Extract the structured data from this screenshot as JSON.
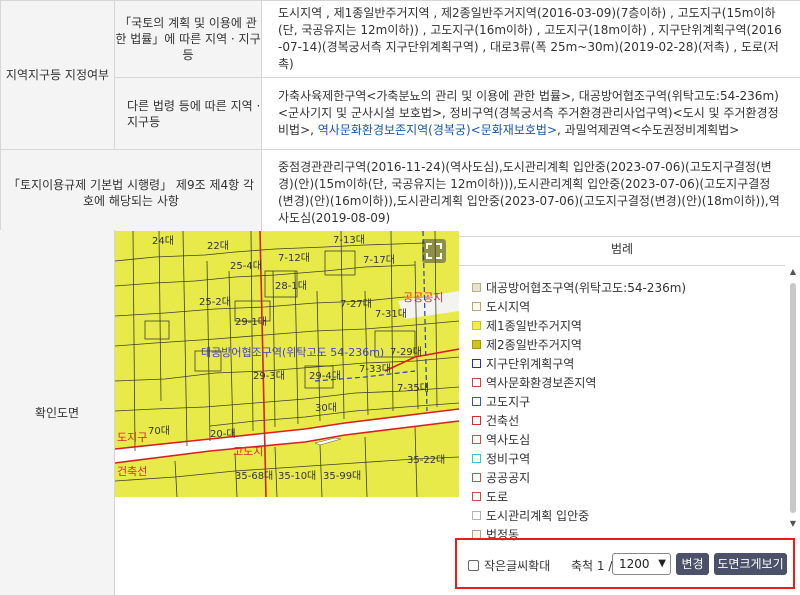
{
  "zoning": {
    "row_label": "지역지구등 지정여부",
    "national_land_header": "「국토의 계획 및 이용에 관한 법률」에 따른 지역 · 지구등",
    "national_land_value": "도시지역 , 제1종일반주거지역 , 제2종일반주거지역(2016-03-09)(7층이하) , 고도지구(15m이하(단, 국공유지는 12m이하)) , 고도지구(16m이하) , 고도지구(18m이하) , 지구단위계획구역(2016-07-14)(경복궁서측 지구단위계획구역) , 대로3류(폭 25m~30m)(2019-02-28)(저촉) , 도로(저촉)",
    "other_law_header": "다른 법령 등에 따른 지역 · 지구등",
    "other_law_value_1": "가축사육제한구역<가축분뇨의 관리 및 이용에 관한 법률>, 대공방어협조구역(위탁고도:54-236m)<군사기지 및 군사시설 보호법>, 정비구역(경복궁서측 주거환경관리사업구역)<도시 및 주거환경정비법>, ",
    "other_law_value_link": "역사문화환경보존지역(경복궁)<문화재보호법>",
    "other_law_value_2": ", 과밀억제권역<수도권정비계획법>"
  },
  "enforcement": {
    "header": "「토지이용규제 기본법 시행령」 제9조 제4항 각 호에 해당되는 사항",
    "value": "중점경관관리구역(2016-11-24)(역사도심),도시관리계획 입안중(2023-07-06)(고도지구결정(변경)(안)(15m이하(단, 국공유지는 12m이하))),도시관리계획 입안중(2023-07-06)(고도지구결정(변경)(안)(16m이하)),도시관리계획 입안중(2023-07-06)(고도지구결정(변경)(안)(18m이하)),역사도심(2019-08-09)"
  },
  "map_section": {
    "label": "확인도면",
    "map_labels": {
      "overlay": "대공방어협조구역(위탁고도 54-236m)",
      "public_space": "공공공지",
      "height_district": "도지구",
      "building_line": "건축선",
      "height_district_2": "고도지"
    },
    "parcels": [
      "24대",
      "22대",
      "25-4대",
      "7-12대",
      "7-13대",
      "7-17대",
      "28-1대",
      "7-31대",
      "25-2대",
      "29-1대",
      "29-4대",
      "7-33대",
      "7-29대",
      "7-27대",
      "29-3대",
      "7-35대",
      "70대",
      "30대",
      "35-68대",
      "35-10대",
      "35-99대",
      "35-22대",
      "20-대"
    ]
  },
  "legend": {
    "title": "범례",
    "items": [
      {
        "label": "대공방어협조구역(위탁고도:54-236m)",
        "color": "#e6e3cf",
        "border": "#b5b08c"
      },
      {
        "label": "도시지역",
        "color": "#fefbe8",
        "border": "#b1aa77"
      },
      {
        "label": "제1종일반주거지역",
        "color": "#f3ee44",
        "border": "#c6c03a"
      },
      {
        "label": "제2종일반주거지역",
        "color": "#d1c411",
        "border": "#a49a12"
      },
      {
        "label": "지구단위계획구역",
        "color": "#ffffff",
        "border": "#2b2fb8"
      },
      {
        "label": "역사문화환경보존지역",
        "color": "#ffffff",
        "border": "#c44545"
      },
      {
        "label": "고도지구",
        "color": "#ffffff",
        "border": "#3c4fc2"
      },
      {
        "label": "건축선",
        "color": "#ffffff",
        "border": "#d52b2b"
      },
      {
        "label": "역사도심",
        "color": "#ffffff",
        "border": "#c74d4d"
      },
      {
        "label": "정비구역",
        "color": "#ffffff",
        "border": "#2fc7d4"
      },
      {
        "label": "공공공지",
        "color": "#ffffff",
        "border": "#c94e4e"
      },
      {
        "label": "도로",
        "color": "#ffffff",
        "border": "#d94444"
      },
      {
        "label": "도시관리계획 입안중",
        "color": "#ffffff",
        "border": "#b3b3b3"
      },
      {
        "label": "법정동",
        "color": "#f6f5e7",
        "border": "#a8a690"
      }
    ]
  },
  "controls": {
    "small_text_label": "작은글씨확대",
    "scale_label": "축척 1 /",
    "scale_value": "1200",
    "change_button": "변경",
    "enlarge_button": "도면크게보기"
  }
}
